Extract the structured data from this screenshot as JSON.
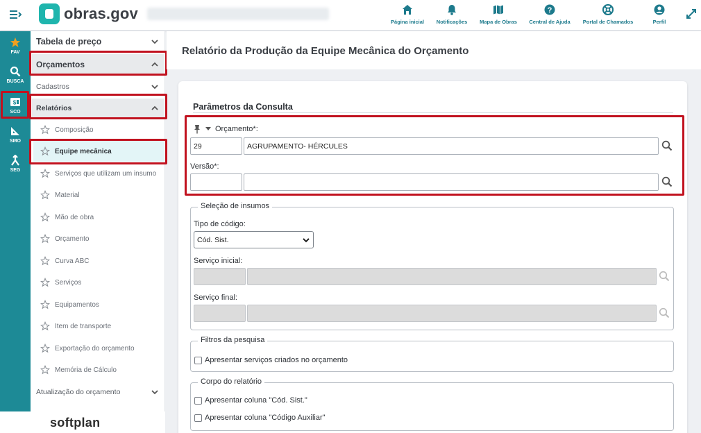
{
  "header": {
    "logo_text": "obras.gov",
    "nav": [
      {
        "label": "Página inicial",
        "icon": "home-icon"
      },
      {
        "label": "Notificações",
        "icon": "bell-icon"
      },
      {
        "label": "Mapa de Obras",
        "icon": "map-icon"
      },
      {
        "label": "Central de Ajuda",
        "icon": "help-icon"
      },
      {
        "label": "Portal de Chamados",
        "icon": "lifebuoy-icon"
      },
      {
        "label": "Perfil",
        "icon": "user-icon"
      }
    ]
  },
  "rail": {
    "items": [
      {
        "label": "FAV",
        "icon": "star-icon"
      },
      {
        "label": "BUSCA",
        "icon": "search-icon"
      },
      {
        "label": "SCO",
        "icon": "sco-icon"
      },
      {
        "label": "SMO",
        "icon": "ruler-icon"
      },
      {
        "label": "SEG",
        "icon": "split-icon"
      }
    ]
  },
  "brand": {
    "footer_logo": "softplan"
  },
  "sidebar": {
    "tabela_preco": "Tabela de preço",
    "orcamentos": "Orçamentos",
    "cadastros": "Cadastros",
    "relatorios": "Relatórios",
    "leaves": [
      "Composição",
      "Equipe mecânica",
      "Serviços que utilizam um insumo",
      "Material",
      "Mão de obra",
      "Orçamento",
      "Curva ABC",
      "Serviços",
      "Equipamentos",
      "Item de transporte",
      "Exportação do orçamento",
      "Memória de Cálculo"
    ],
    "active_leaf": "Equipe mecânica",
    "atualizacao": "Atualização do orçamento"
  },
  "page": {
    "title": "Relatório da Produção da Equipe Mecânica do Orçamento",
    "section_title": "Parâmetros da Consulta",
    "orcamento": {
      "label": "Orçamento*:",
      "code": "29",
      "name": "AGRUPAMENTO- HÉRCULES"
    },
    "versao": {
      "label": "Versão*:",
      "code": "",
      "name": ""
    },
    "selecao": {
      "legend": "Seleção de insumos",
      "tipo_label": "Tipo de código:",
      "tipo_value": "Cód. Sist.",
      "servico_inicial_label": "Serviço inicial:",
      "servico_final_label": "Serviço final:"
    },
    "filtros": {
      "legend": "Filtros da pesquisa",
      "option1": "Apresentar serviços criados no orçamento"
    },
    "corpo": {
      "legend": "Corpo do relatório",
      "option1": "Apresentar coluna \"Cód. Sist.\"",
      "option2": "Apresentar coluna \"Código Auxiliar\""
    }
  },
  "colors": {
    "accent": "#1d8a96",
    "highlight_border": "#c1121f",
    "active_bg": "#e3f5f7"
  }
}
